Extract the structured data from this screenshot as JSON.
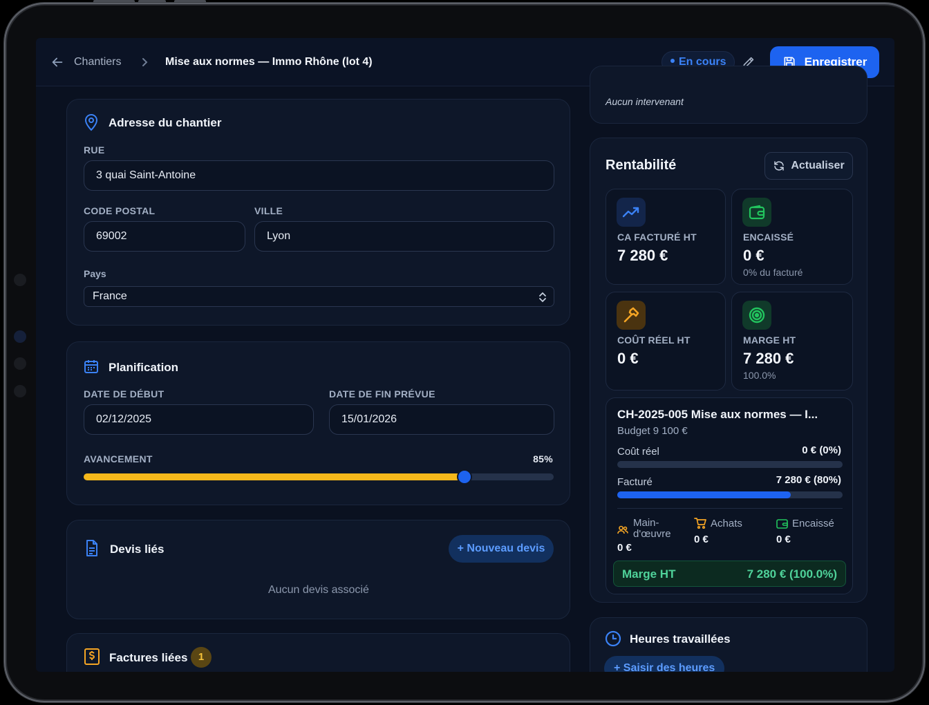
{
  "header": {
    "breadcrumb_link": "Chantiers",
    "title": "Mise aux normes — Immo Rhône (lot 4)",
    "status": "En cours",
    "save_label": "Enregistrer"
  },
  "address": {
    "title": "Adresse du chantier",
    "rue_label": "RUE",
    "rue_value": "3 quai Saint-Antoine",
    "cp_label": "CODE POSTAL",
    "cp_value": "69002",
    "ville_label": "VILLE",
    "ville_value": "Lyon",
    "pays_label": "Pays",
    "pays_value": "France"
  },
  "planning": {
    "title": "Planification",
    "start_label": "DATE DE DÉBUT",
    "start_value": "02/12/2025",
    "end_label": "DATE DE FIN PRÉVUE",
    "end_value": "15/01/2026",
    "progress_label": "AVANCEMENT",
    "progress_text": "85%",
    "progress_fraction": 0.81
  },
  "devis": {
    "title": "Devis liés",
    "new_label": "+ Nouveau devis",
    "empty": "Aucun devis associé"
  },
  "factures": {
    "title": "Factures liées",
    "count": "1"
  },
  "intervenants": {
    "empty": "Aucun intervenant"
  },
  "rentabilite": {
    "title": "Rentabilité",
    "refresh_label": "Actualiser",
    "kpis": [
      {
        "label": "CA FACTURÉ HT",
        "value": "7 280 €",
        "sub": "",
        "icon": "trending-up-icon",
        "color": "#3b82f6"
      },
      {
        "label": "ENCAISSÉ",
        "value": "0 €",
        "sub": "0% du facturé",
        "icon": "wallet-icon",
        "color": "#22c55e"
      },
      {
        "label": "COÛT RÉEL HT",
        "value": "0 €",
        "sub": "",
        "icon": "hammer-icon",
        "color": "#f5a524"
      },
      {
        "label": "MARGE HT",
        "value": "7 280 €",
        "sub": "100.0%",
        "icon": "target-icon",
        "color": "#22c55e"
      }
    ],
    "project": {
      "name": "CH-2025-005 Mise aux normes — I...",
      "budget": "Budget 9 100 €",
      "cout_label": "Coût réel",
      "cout_value": "0 € (0%)",
      "cout_fraction": 0,
      "facture_label": "Facturé",
      "facture_value": "7 280 € (80%)",
      "facture_fraction": 0.77,
      "main_oeuvre_label_1": "Main-",
      "main_oeuvre_label_2": "d'œuvre",
      "main_oeuvre_value": "0 €",
      "achats_label": "Achats",
      "achats_value": "0 €",
      "encaisse_label": "Encaissé",
      "encaisse_value": "0 €",
      "marge_label": "Marge HT",
      "marge_value": "7 280 € (100.0%)"
    }
  },
  "heures": {
    "title": "Heures travaillées",
    "add_label": "+ Saisir des heures"
  }
}
